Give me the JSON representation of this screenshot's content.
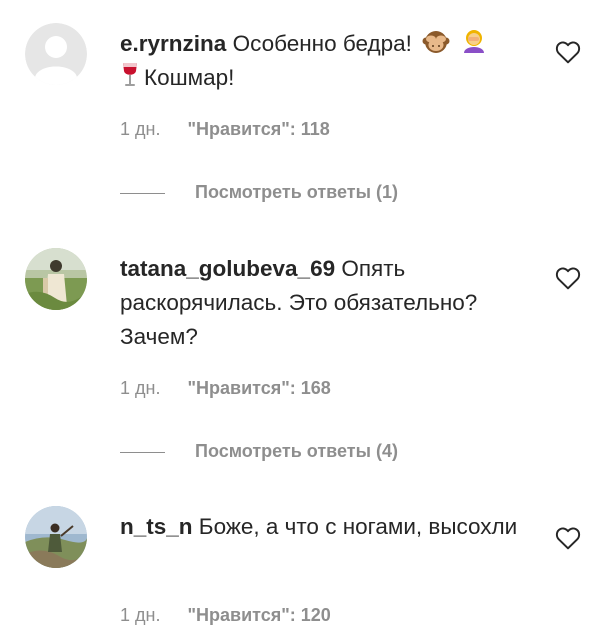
{
  "comments": [
    {
      "username": "e.ryrnzina",
      "text_part1": "Особенно бедра!",
      "emoji_1": "see-no-evil-monkey",
      "emoji_2": "woman-facepalming",
      "emoji_3": "wine-glass",
      "text_part2": "Кошмар!",
      "time": "1 дн.",
      "likes": "\"Нравится\": 118",
      "replies": "Посмотреть ответы (1)"
    },
    {
      "username": "tatana_golubeva_69",
      "text": "Опять раскорячилась. Это обязательно? Зачем?",
      "time": "1 дн.",
      "likes": "\"Нравится\": 168",
      "replies": "Посмотреть ответы (4)"
    },
    {
      "username": "n_ts_n",
      "text": "Боже, а что с ногами, высохли",
      "time": "1 дн.",
      "likes": "\"Нравится\": 120"
    }
  ],
  "icons": {
    "like": "heart-outline-icon",
    "default_avatar": "default-avatar-icon"
  },
  "colors": {
    "text": "#262626",
    "secondary": "#8e8e8e",
    "background": "#ffffff"
  }
}
